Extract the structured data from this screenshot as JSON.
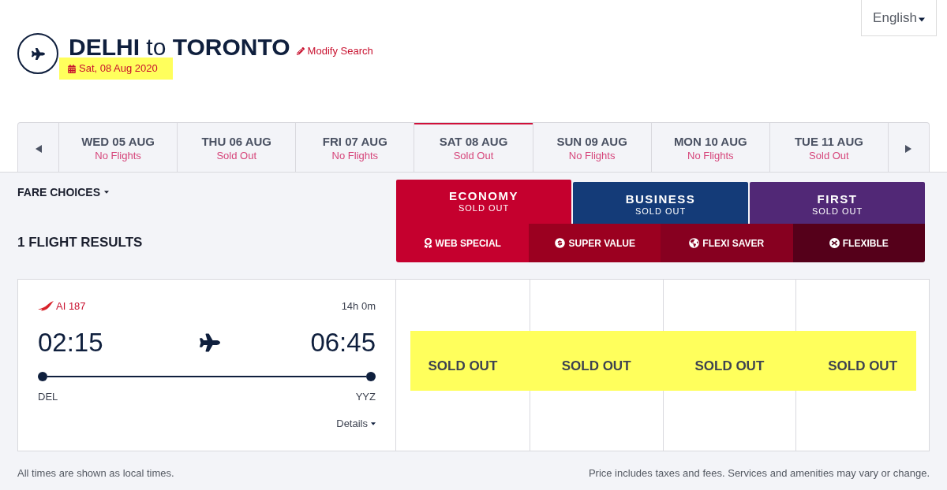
{
  "language": {
    "label": "English"
  },
  "header": {
    "title": "**DELHI** to **TORONTO**",
    "modify_link": "Modify Search",
    "date": {
      "text": "Sat, 08 Aug 2020",
      "highlighted": true
    }
  },
  "date_strip": {
    "days": [
      {
        "label": "WED 05 AUG",
        "status": "No Flights",
        "selected": false
      },
      {
        "label": "THU 06 AUG",
        "status": "Sold Out",
        "selected": false
      },
      {
        "label": "FRI 07 AUG",
        "status": "No Flights",
        "selected": false
      },
      {
        "label": "SAT 08 AUG",
        "status": "Sold Out",
        "selected": true
      },
      {
        "label": "SUN 09 AUG",
        "status": "No Flights",
        "selected": false
      },
      {
        "label": "MON 10 AUG",
        "status": "No Flights",
        "selected": false
      },
      {
        "label": "TUE 11 AUG",
        "status": "Sold Out",
        "selected": false
      }
    ]
  },
  "fare_choices": {
    "label": "FARE CHOICES"
  },
  "results_count": "1 FLIGHT RESULTS",
  "cabin_tabs": [
    {
      "name": "ECONOMY",
      "status": "SOLD OUT",
      "selected": true,
      "color": "#c5002e"
    },
    {
      "name": "BUSINESS",
      "status": "SOLD OUT",
      "selected": false,
      "color": "#143b78"
    },
    {
      "name": "FIRST",
      "status": "SOLD OUT",
      "selected": false,
      "color": "#512876"
    }
  ],
  "fare_types": [
    {
      "label": "WEB SPECIAL",
      "color": "#c5002e"
    },
    {
      "label": "SUPER VALUE",
      "color": "#9b0020"
    },
    {
      "label": "FLEXI SAVER",
      "color": "#870020"
    },
    {
      "label": "FLEXIBLE",
      "color": "#55001a"
    }
  ],
  "flights": [
    {
      "flight_number": "AI 187",
      "duration": "14h 0m",
      "departure_time": "02:15",
      "arrival_time": "06:45",
      "origin": "DEL",
      "destination": "YYZ",
      "details_link": "Details",
      "fares": [
        "SOLD OUT",
        "SOLD OUT",
        "SOLD OUT",
        "SOLD OUT"
      ],
      "fares_highlighted": true
    }
  ],
  "footer": {
    "note": "All times are shown as local times.",
    "disclaimer": "Price includes taxes and fees. Services and amenities may vary or change."
  }
}
